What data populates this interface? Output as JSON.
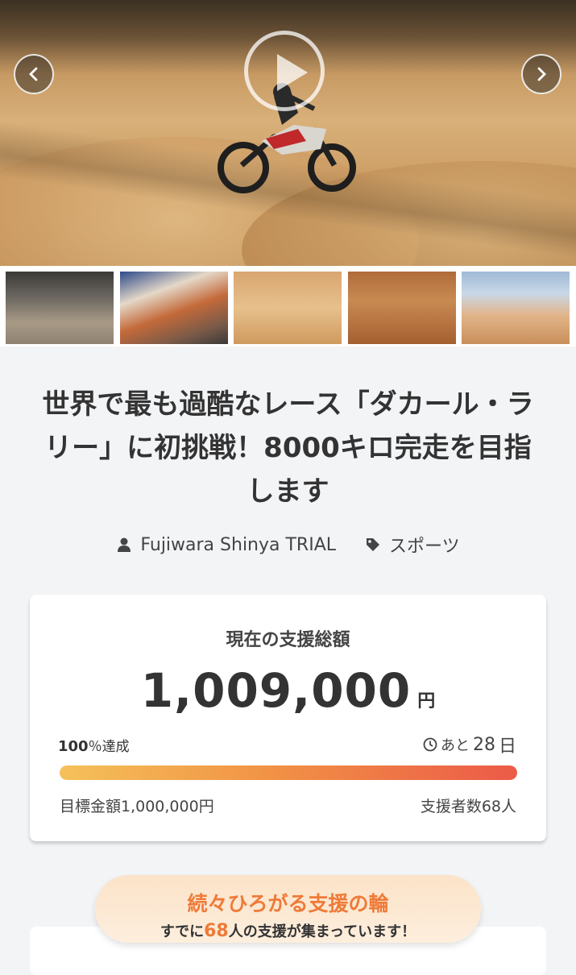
{
  "gallery": {
    "play_label": "play video",
    "thumbnails": [
      "thumb-1",
      "thumb-2",
      "thumb-3",
      "thumb-4",
      "thumb-5"
    ]
  },
  "project": {
    "title": "世界で最も過酷なレース「ダカール・ラリー」に初挑戦！8000キロ完走を目指します",
    "author": "Fujiwara Shinya TRIAL",
    "category": "スポーツ"
  },
  "funding": {
    "label": "現在の支援総額",
    "amount": "1,009,000",
    "currency": "円",
    "rate_value": "100",
    "rate_suffix": "％達成",
    "progress_percent": 100,
    "days_prefix": "あと",
    "days_value": "28",
    "days_unit": "日",
    "goal": "目標金額1,000,000円",
    "backers": "支援者数68人"
  },
  "banner": {
    "headline": "続々ひろがる支援の輪",
    "sub_prefix": "すでに",
    "sub_count": "68",
    "sub_suffix": "人の支援が集まっています！"
  },
  "colors": {
    "accent": "#ef7a38",
    "bar_start": "#f5c15a",
    "bar_end": "#ec5a48"
  },
  "icons": [
    "chevron-left-icon",
    "chevron-right-icon",
    "play-icon",
    "user-icon",
    "tag-icon",
    "clock-icon"
  ]
}
